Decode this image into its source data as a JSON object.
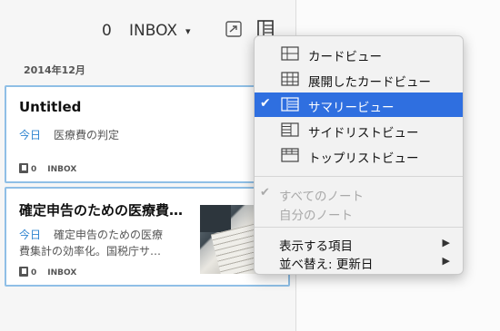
{
  "header": {
    "note_count": "0",
    "notebook": "INBOX"
  },
  "month": "2014年12月",
  "notes": [
    {
      "title": "Untitled",
      "date": "今日",
      "snippet": "医療費の判定",
      "tag_count": "0",
      "notebook": "INBOX"
    },
    {
      "title": "確定申告のための医療費集計の効率化。国税庁サ…",
      "date": "今日",
      "snippet_line1": "確定申告のための医療",
      "snippet_line2": "費集計の効率化。国税庁サ…",
      "tag_count": "0",
      "notebook": "INBOX"
    }
  ],
  "menu": {
    "views": [
      {
        "label": "カードビュー",
        "icon": "card-view-icon"
      },
      {
        "label": "展開したカードビュー",
        "icon": "expanded-card-view-icon"
      },
      {
        "label": "サマリービュー",
        "icon": "summary-view-icon",
        "selected": true
      },
      {
        "label": "サイドリストビュー",
        "icon": "side-list-view-icon"
      },
      {
        "label": "トップリストビュー",
        "icon": "top-list-view-icon"
      }
    ],
    "filters": [
      {
        "label": "すべてのノート",
        "checked": true
      },
      {
        "label": "自分のノート"
      }
    ],
    "options": [
      {
        "label": "表示する項目"
      },
      {
        "label": "並べ替え: 更新日"
      }
    ],
    "check_mark": "✔",
    "arrow": "▶"
  }
}
